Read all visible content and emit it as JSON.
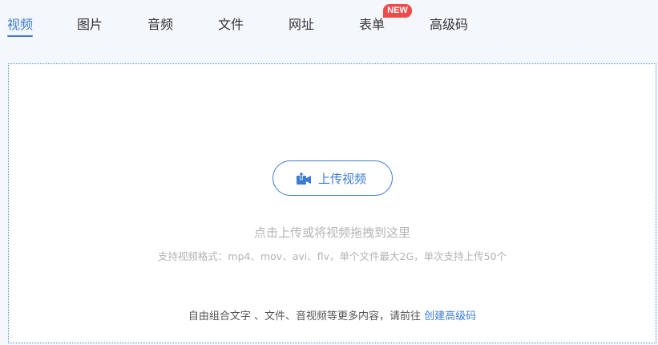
{
  "tabs": [
    {
      "label": "视频",
      "active": true
    },
    {
      "label": "图片"
    },
    {
      "label": "音频"
    },
    {
      "label": "文件"
    },
    {
      "label": "网址"
    },
    {
      "label": "表单",
      "badge": "NEW"
    },
    {
      "label": "高级码"
    }
  ],
  "upload": {
    "button_label": "上传视频",
    "icon": "upload-video-icon",
    "hint": "点击上传或将视频拖拽到这里",
    "formats": "支持视频格式：mp4、mov、avi、flv，单个文件最大2G，单次支持上传50个"
  },
  "footer": {
    "text": "自由组合文字 、文件、音视频等更多内容，请前往",
    "link": "创建高级码"
  },
  "colors": {
    "accent": "#3a7bd5",
    "badge": "#f04b4b",
    "hint": "#b3b3b3"
  }
}
